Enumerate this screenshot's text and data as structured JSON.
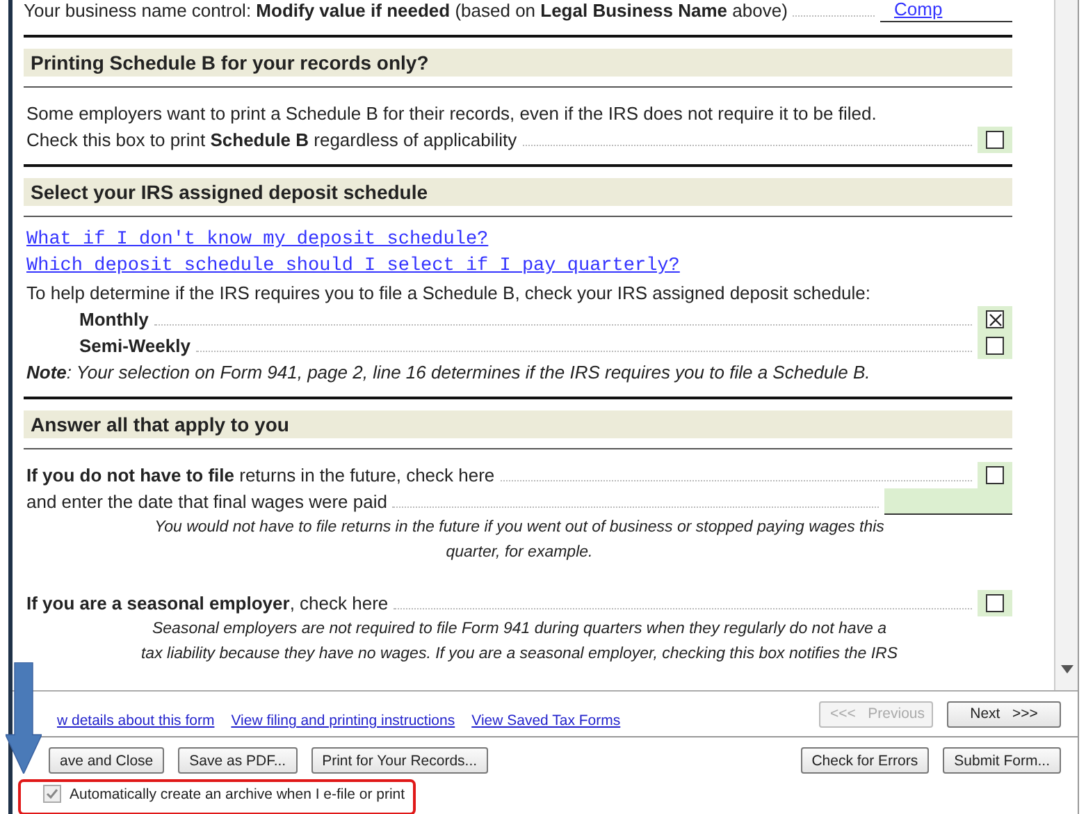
{
  "form": {
    "top_line": {
      "text": "Your business name control: **Modify value if needed** (based on **Legal Business Name** above)",
      "value": "Comp"
    },
    "sections": [
      {
        "heading": "Printing Schedule B for your records only?",
        "items": [
          {
            "kind": "text",
            "text": "Some employers want to print a Schedule B for their records, even if the IRS does not require it to be filed."
          },
          {
            "kind": "check",
            "text": "Check this box to print **Schedule B** regardless of applicability",
            "checked": false
          }
        ]
      },
      {
        "heading": "Select your IRS assigned deposit schedule",
        "items": [
          {
            "kind": "link",
            "text": "What if I don't know my deposit schedule?"
          },
          {
            "kind": "link",
            "text": "Which deposit schedule should I select if I pay quarterly?"
          },
          {
            "kind": "text",
            "text": "To help determine if the IRS requires you to file a Schedule B, check your IRS assigned deposit schedule:"
          },
          {
            "kind": "option",
            "text": "**Monthly**",
            "checked": true
          },
          {
            "kind": "option",
            "text": "**Semi-Weekly**",
            "checked": false
          },
          {
            "kind": "note",
            "text": "**Note**: Your selection on Form 941, page 2, line 16 determines if the IRS requires you to file a Schedule B."
          }
        ]
      },
      {
        "heading": "Answer all that apply to you",
        "items": [
          {
            "kind": "check",
            "text": "**If you do not have to file** returns in the future, check here",
            "checked": false
          },
          {
            "kind": "date",
            "text": "and enter the date that final wages were paid"
          },
          {
            "kind": "hint",
            "text": "You would not have to file returns in the future if you went out of business or stopped paying wages this quarter, for example."
          },
          {
            "kind": "check",
            "text": "**If you are a seasonal employer**, check here",
            "checked": false
          },
          {
            "kind": "hint",
            "text": "Seasonal employers are not required to file Form 941 during quarters when they regularly do not have a tax liability because they have no wages. If you are a seasonal employer, checking this box notifies the IRS"
          }
        ]
      }
    ]
  },
  "footer": {
    "links": [
      "w details about this form",
      "View filing and printing instructions",
      "View Saved Tax Forms"
    ],
    "nav_buttons": [
      {
        "label": "<<<   Previous",
        "disabled": true
      },
      {
        "label": "Next   >>>",
        "disabled": false
      }
    ],
    "left_buttons": [
      "ave and Close",
      "Save as PDF...",
      "Print for Your Records..."
    ],
    "right_buttons": [
      "Check for Errors",
      "Submit Form..."
    ],
    "archive_option": {
      "label": "Automatically create an archive when I e-file or print",
      "checked": true
    }
  }
}
